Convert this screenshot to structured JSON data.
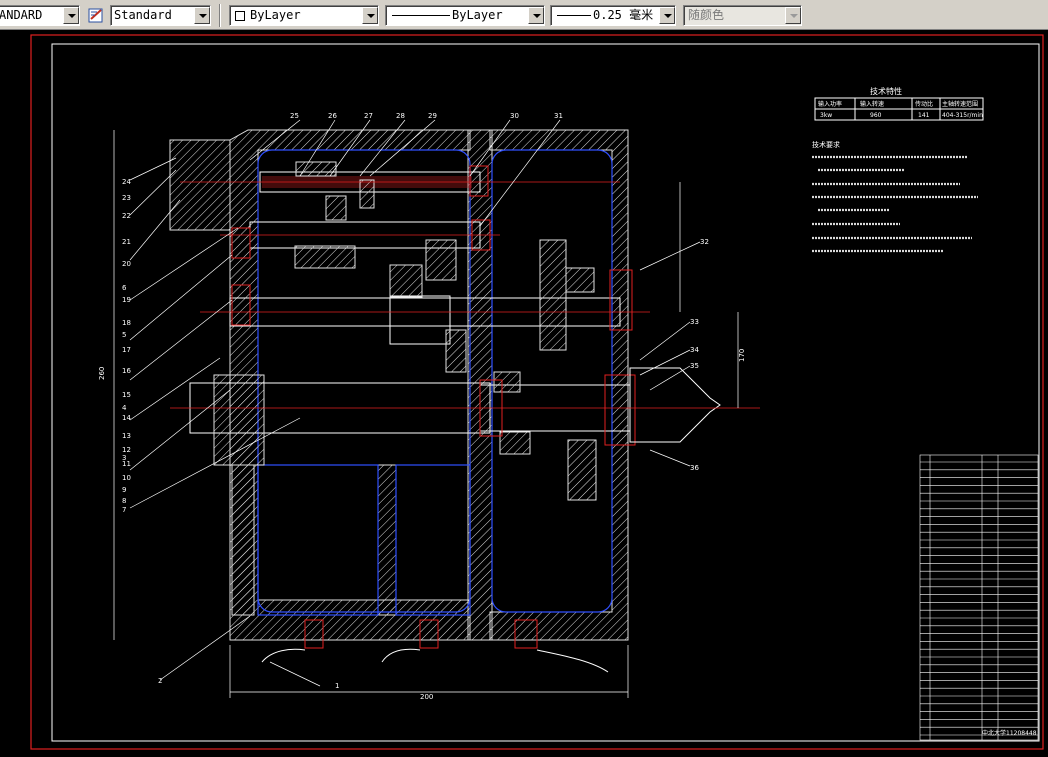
{
  "toolbar": {
    "text_style": "ANDARD",
    "dim_style": "Standard",
    "layer_color": "ByLayer",
    "linetype": "ByLayer",
    "lineweight": "0.25 毫米",
    "plot_style": "随颜色"
  },
  "drawing": {
    "title_block_name": "中北大学11208448",
    "part_numbers_left": [
      "24",
      "23",
      "22",
      "21",
      "20",
      "19",
      "18",
      "17",
      "16",
      "15",
      "14",
      "13",
      "12",
      "11",
      "10",
      "9",
      "8",
      "7",
      "6",
      "5",
      "4",
      "3",
      "2"
    ],
    "part_numbers_top": [
      "25",
      "26",
      "27",
      "28",
      "29",
      "30",
      "31"
    ],
    "part_numbers_right": [
      "32",
      "33",
      "34",
      "35",
      "36"
    ],
    "part_numbers_bottom": [
      "1"
    ],
    "dim_bottom": "200",
    "dim_left": "260",
    "dim_right": "170",
    "tech_table_title": "技术特性",
    "tech_table_header": [
      "输入功率",
      "输入转速",
      "传动比",
      "主轴转速范围"
    ],
    "tech_table_row": [
      "3kw",
      "960",
      "141",
      "404-315r/min"
    ],
    "tech_req_title": "技术要求"
  }
}
